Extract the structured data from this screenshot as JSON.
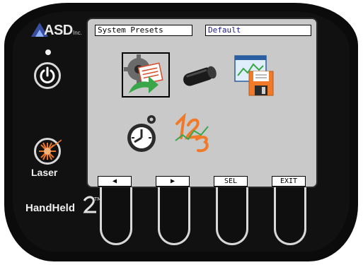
{
  "device": {
    "brand": "ASD",
    "brand_suffix": "Inc.",
    "model": "HandHeld",
    "model_mark": "2™",
    "laser_label": "Laser",
    "power_icon": "power-icon",
    "laser_icon": "laser-burst-icon"
  },
  "screen": {
    "title": "System Presets",
    "preset_value": "Default",
    "icons": [
      {
        "name": "settings-export-icon",
        "selected": true
      },
      {
        "name": "sensor-tube-icon",
        "selected": false
      },
      {
        "name": "save-chart-icon",
        "selected": false
      },
      {
        "name": "stopwatch-icon",
        "selected": false
      },
      {
        "name": "numbers-123-icon",
        "selected": false
      }
    ],
    "softkeys": [
      "◀",
      "▶",
      "SEL",
      "EXIT"
    ]
  },
  "colors": {
    "body": "#0b0b0b",
    "screen": "#c9c9c9",
    "laser_accent": "#e8742a",
    "icon_orange": "#f07a2a",
    "icon_green": "#3aa64a"
  }
}
